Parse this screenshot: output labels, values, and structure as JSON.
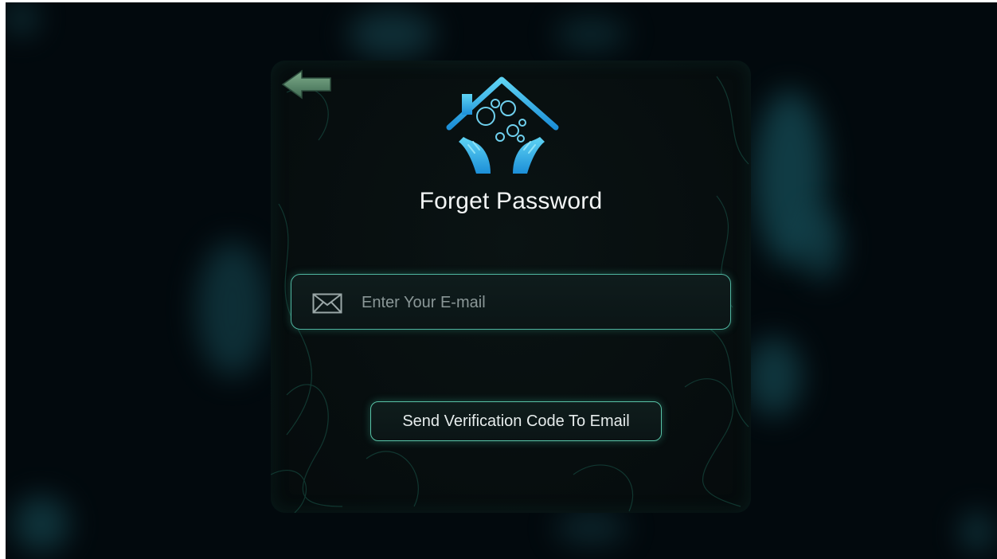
{
  "page": {
    "title": "Forget Password"
  },
  "icons": {
    "back": "back-arrow-icon",
    "logo": "house-hands-logo",
    "email": "envelope-icon"
  },
  "email_field": {
    "value": "",
    "placeholder": "Enter Your E-mail"
  },
  "actions": {
    "send_code_label": "Send Verification Code To Email"
  },
  "colors": {
    "background": "#02090d",
    "accent": "#4fb5a0",
    "logo_blue": "#2aa8e8",
    "text": "#f2f5f5"
  }
}
